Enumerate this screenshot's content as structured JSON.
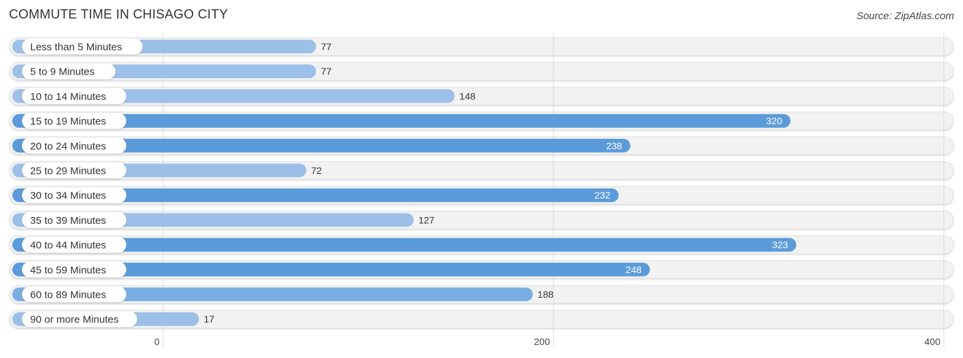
{
  "header": {
    "title": "COMMUTE TIME IN CHISAGO CITY",
    "source": "Source: ZipAtlas.com"
  },
  "colors": {
    "bar_strong": "#5b9bd9",
    "bar_light": "#9dc0e8",
    "track": "#f2f2f2",
    "grid": "#d8d8d8"
  },
  "chart_data": {
    "type": "bar",
    "orientation": "horizontal",
    "title": "COMMUTE TIME IN CHISAGO CITY",
    "xlabel": "",
    "ylabel": "",
    "xlim": [
      0,
      400
    ],
    "grid": true,
    "x_ticks": [
      0,
      200,
      400
    ],
    "x_tick_labels": [
      "0",
      "200",
      "400"
    ],
    "categories": [
      "Less than 5 Minutes",
      "5 to 9 Minutes",
      "10 to 14 Minutes",
      "15 to 19 Minutes",
      "20 to 24 Minutes",
      "25 to 29 Minutes",
      "30 to 34 Minutes",
      "35 to 39 Minutes",
      "40 to 44 Minutes",
      "45 to 59 Minutes",
      "60 to 89 Minutes",
      "90 or more Minutes"
    ],
    "values": [
      77,
      77,
      148,
      320,
      238,
      72,
      232,
      127,
      323,
      248,
      188,
      17
    ],
    "value_labels": [
      "77",
      "77",
      "148",
      "320",
      "238",
      "72",
      "232",
      "127",
      "323",
      "248",
      "188",
      "17"
    ]
  }
}
